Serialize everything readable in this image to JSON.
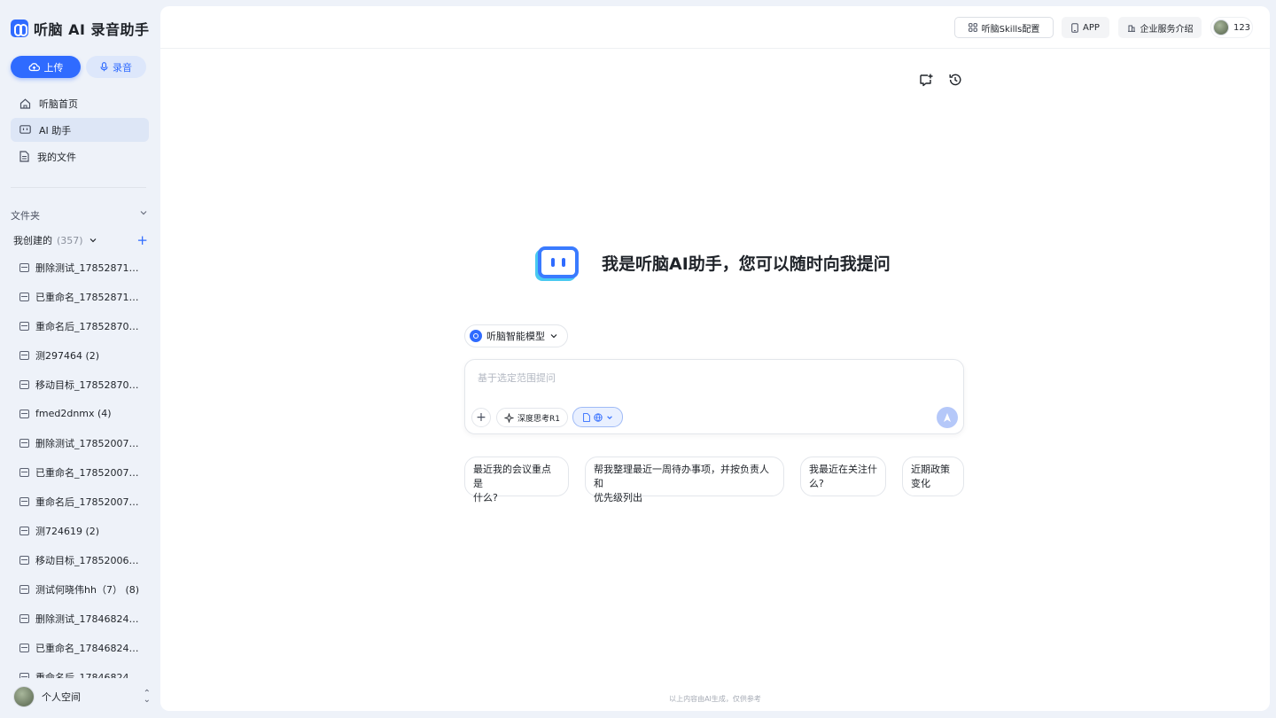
{
  "brand": {
    "title": "听脑 AI 录音助手"
  },
  "actions": {
    "upload": "上传",
    "record": "录音"
  },
  "nav": [
    {
      "label": "听脑首页",
      "active": false
    },
    {
      "label": "AI 助手",
      "active": true
    },
    {
      "label": "我的文件",
      "active": false
    }
  ],
  "folders": {
    "title": "文件夹",
    "mine_label": "我创建的",
    "mine_count": "(357)",
    "items": [
      "删除测试_1785287120 ...",
      "已重命名_1785287107 (...",
      "重命名后_1785287096 ...",
      "测297464 (2)",
      "移动目标_1785287046 ...",
      "fmed2dnmx (4)",
      "删除测试_1785200743 ...",
      "已重命名_1785200729 ...",
      "重命名后_1785200720 ...",
      "测724619 (2)",
      "移动目标_1785200673 ...",
      "测试何晓伟hh（7） (8)",
      "删除测试_1784682455 ...",
      "已重命名_1784682438 ...",
      "重命名后_1784682426 ..."
    ]
  },
  "workspace": {
    "label": "个人空间"
  },
  "topbar": {
    "skills": "听脑Skills配置",
    "app": "APP",
    "enterprise": "企业服务介绍",
    "user": "123"
  },
  "hero": {
    "title": "我是听脑AI助手，您可以随时向我提问"
  },
  "composer": {
    "model": "听脑智能模型",
    "placeholder": "基于选定范围提问",
    "value": "",
    "deep_think": "深度思考R1"
  },
  "suggestions": [
    {
      "line1": "最近我的会议重点是",
      "line2": "什么?"
    },
    {
      "line1": "帮我整理最近一周待办事项，并按负责人和",
      "line2": "优先级列出"
    },
    {
      "line1": "我最近在关注什",
      "line2": "么?"
    },
    {
      "line1": "近期政策",
      "line2": "变化"
    }
  ],
  "footer": {
    "note": "以上内容由AI生成，仅供参考"
  },
  "colors": {
    "accent": "#2f6bff",
    "sidebar_bg": "#eef2f9",
    "active_item": "#dde6f6"
  }
}
